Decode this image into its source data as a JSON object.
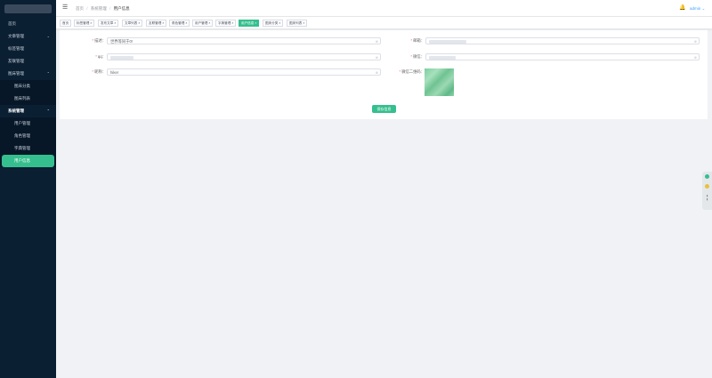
{
  "sidebar": {
    "items": [
      {
        "label": "首页",
        "arrow": ""
      },
      {
        "label": "文章管理",
        "arrow": "⌄"
      },
      {
        "label": "标签管理",
        "arrow": ""
      },
      {
        "label": "友联管理",
        "arrow": ""
      },
      {
        "label": "图床管理",
        "arrow": "⌃"
      }
    ],
    "gallery_sub": [
      "图床分类",
      "图床列表"
    ],
    "system": {
      "label": "系统管理",
      "arrow": "⌃"
    },
    "system_sub": [
      "用户管理",
      "角色管理",
      "字典管理"
    ],
    "active_item": "用户信息"
  },
  "header": {
    "toggle_icon": "☰",
    "breadcrumb": [
      "首页",
      "系统管理",
      "用户信息"
    ],
    "separator": "/",
    "bell_icon": "🔔",
    "user": "admin ⌄"
  },
  "tags": [
    {
      "label": "首页",
      "close": ""
    },
    {
      "label": "标签管理",
      "close": "×"
    },
    {
      "label": "发布文章",
      "close": "×"
    },
    {
      "label": "文章列表",
      "close": "×"
    },
    {
      "label": "友联管理",
      "close": "×"
    },
    {
      "label": "角色管理",
      "close": "×"
    },
    {
      "label": "用户管理",
      "close": "×"
    },
    {
      "label": "字典管理",
      "close": "×"
    },
    {
      "label": "用户信息",
      "close": "×"
    },
    {
      "label": "图床分类",
      "close": "×"
    },
    {
      "label": "图床列表",
      "close": "×"
    }
  ],
  "form": {
    "required_mark": "*",
    "desc_label": "描述：",
    "desc_value": "世界等同于0!",
    "qq_label": "qq：",
    "nickname_label": "昵称：",
    "nickname_value": "hiker",
    "email_label": "邮箱：",
    "wechat_label": "微信：",
    "qr_label": "微信二维码：",
    "clear_icon": "⊗",
    "save_button": "保存信息"
  },
  "accent_color": "#35bf8e"
}
